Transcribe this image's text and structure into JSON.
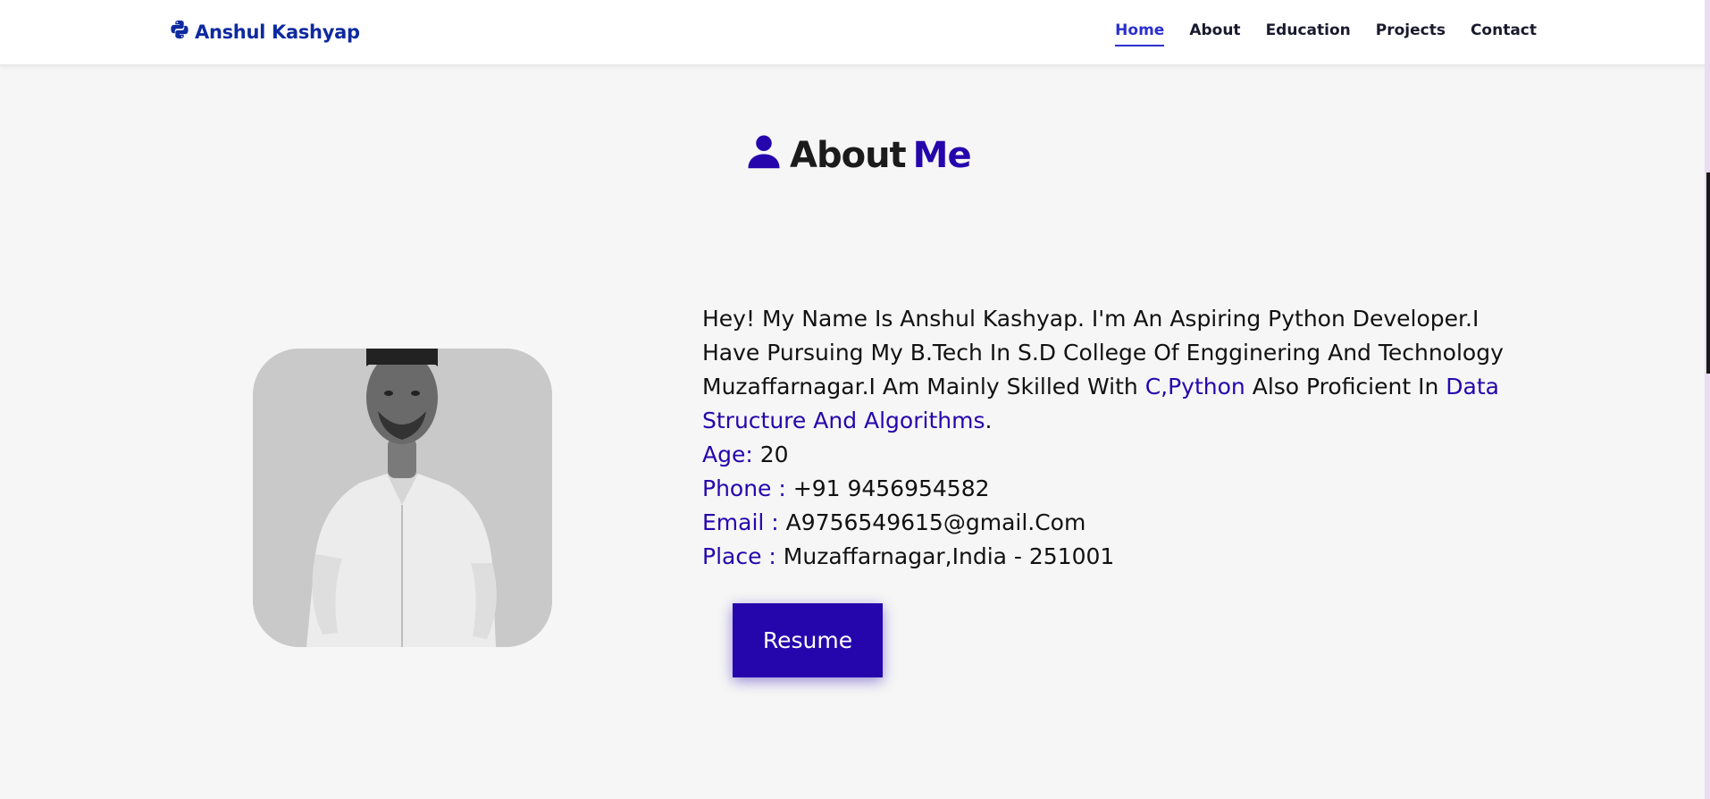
{
  "header": {
    "brand_name": "Anshul Kashyap",
    "brand_icon": "python-icon",
    "nav": [
      {
        "label": "Home",
        "active": true
      },
      {
        "label": "About",
        "active": false
      },
      {
        "label": "Education",
        "active": false
      },
      {
        "label": "Projects",
        "active": false
      },
      {
        "label": "Contact",
        "active": false
      }
    ]
  },
  "section": {
    "icon": "user-icon",
    "title_word": "About",
    "title_accent": "Me"
  },
  "about": {
    "intro_part1": "Hey! My Name Is Anshul Kashyap. I'm An Aspiring Python Developer.I Have Pursuing My B.Tech In S.D College Of Engginering And Technology Muzaffarnagar.I Am Mainly Skilled With ",
    "skills": "C,Python",
    "intro_part2": " Also Proficient In ",
    "proficiency": "Data Structure And Algorithms",
    "intro_end": ".",
    "age_label": "Age:",
    "age_value": " 20",
    "phone_label": "Phone :",
    "phone_value": " +91 9456954582",
    "email_label": "Email :",
    "email_value": " A9756549615@gmail.Com",
    "place_label": "Place :",
    "place_value": " Muzaffarnagar,India - 251001",
    "resume_label": "Resume"
  },
  "colors": {
    "accent": "#2506ad",
    "brand": "#0e2aa0",
    "nav_active": "#2b2fcf",
    "background": "#f6f6f6"
  }
}
